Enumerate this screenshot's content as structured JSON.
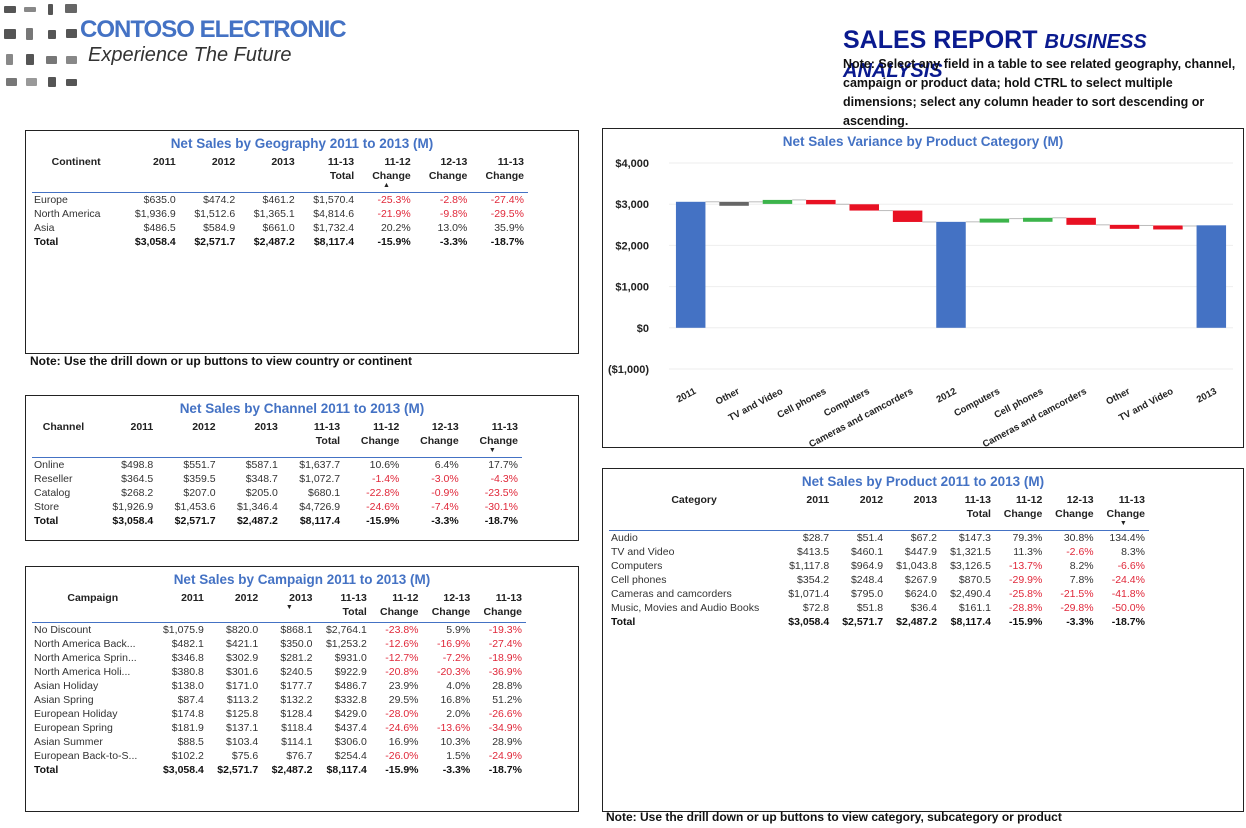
{
  "brand": {
    "name": "CONTOSO ELECTRONIC",
    "tagline": "Experience The Future"
  },
  "report": {
    "title": "SALES REPORT",
    "subtitle": "BUSINESS ANALYSIS",
    "note": "Note: Select any field in a table to see related geography, channel, campaign or product data; hold CTRL to select multiple dimensions; select any column header to sort descending or ascending."
  },
  "geography": {
    "title": "Net Sales by Geography 2011 to 2013 (M)",
    "headers": [
      "Continent",
      "2011",
      "2012",
      "2013",
      "11-13 Total",
      "11-12 Change",
      "12-13 Change",
      "11-13 Change"
    ],
    "rows": [
      [
        "Europe",
        "$635.0",
        "$474.2",
        "$461.2",
        "$1,570.4",
        "-25.3%",
        "-2.8%",
        "-27.4%"
      ],
      [
        "North America",
        "$1,936.9",
        "$1,512.6",
        "$1,365.1",
        "$4,814.6",
        "-21.9%",
        "-9.8%",
        "-29.5%"
      ],
      [
        "Asia",
        "$486.5",
        "$584.9",
        "$661.0",
        "$1,732.4",
        "20.2%",
        "13.0%",
        "35.9%"
      ]
    ],
    "total": [
      "Total",
      "$3,058.4",
      "$2,571.7",
      "$2,487.2",
      "$8,117.4",
      "-15.9%",
      "-3.3%",
      "-18.7%"
    ],
    "note": "Note: Use the drill down or up buttons to view country or continent"
  },
  "channel": {
    "title": "Net Sales by Channel 2011 to 2013 (M)",
    "headers": [
      "Channel",
      "2011",
      "2012",
      "2013",
      "11-13 Total",
      "11-12 Change",
      "12-13 Change",
      "11-13 Change"
    ],
    "rows": [
      [
        "Online",
        "$498.8",
        "$551.7",
        "$587.1",
        "$1,637.7",
        "10.6%",
        "6.4%",
        "17.7%"
      ],
      [
        "Reseller",
        "$364.5",
        "$359.5",
        "$348.7",
        "$1,072.7",
        "-1.4%",
        "-3.0%",
        "-4.3%"
      ],
      [
        "Catalog",
        "$268.2",
        "$207.0",
        "$205.0",
        "$680.1",
        "-22.8%",
        "-0.9%",
        "-23.5%"
      ],
      [
        "Store",
        "$1,926.9",
        "$1,453.6",
        "$1,346.4",
        "$4,726.9",
        "-24.6%",
        "-7.4%",
        "-30.1%"
      ]
    ],
    "total": [
      "Total",
      "$3,058.4",
      "$2,571.7",
      "$2,487.2",
      "$8,117.4",
      "-15.9%",
      "-3.3%",
      "-18.7%"
    ]
  },
  "campaign": {
    "title": "Net Sales by Campaign 2011 to 2013 (M)",
    "headers": [
      "Campaign",
      "2011",
      "2012",
      "2013",
      "11-13 Total",
      "11-12 Change",
      "12-13 Change",
      "11-13 Change"
    ],
    "rows": [
      [
        "No Discount",
        "$1,075.9",
        "$820.0",
        "$868.1",
        "$2,764.1",
        "-23.8%",
        "5.9%",
        "-19.3%"
      ],
      [
        "North America Back...",
        "$482.1",
        "$421.1",
        "$350.0",
        "$1,253.2",
        "-12.6%",
        "-16.9%",
        "-27.4%"
      ],
      [
        "North America Sprin...",
        "$346.8",
        "$302.9",
        "$281.2",
        "$931.0",
        "-12.7%",
        "-7.2%",
        "-18.9%"
      ],
      [
        "North America Holi...",
        "$380.8",
        "$301.6",
        "$240.5",
        "$922.9",
        "-20.8%",
        "-20.3%",
        "-36.9%"
      ],
      [
        "Asian Holiday",
        "$138.0",
        "$171.0",
        "$177.7",
        "$486.7",
        "23.9%",
        "4.0%",
        "28.8%"
      ],
      [
        "Asian Spring",
        "$87.4",
        "$113.2",
        "$132.2",
        "$332.8",
        "29.5%",
        "16.8%",
        "51.2%"
      ],
      [
        "European Holiday",
        "$174.8",
        "$125.8",
        "$128.4",
        "$429.0",
        "-28.0%",
        "2.0%",
        "-26.6%"
      ],
      [
        "European Spring",
        "$181.9",
        "$137.1",
        "$118.4",
        "$437.4",
        "-24.6%",
        "-13.6%",
        "-34.9%"
      ],
      [
        "Asian Summer",
        "$88.5",
        "$103.4",
        "$114.1",
        "$306.0",
        "16.9%",
        "10.3%",
        "28.9%"
      ],
      [
        "European Back-to-S...",
        "$102.2",
        "$75.6",
        "$76.7",
        "$254.4",
        "-26.0%",
        "1.5%",
        "-24.9%"
      ]
    ],
    "total": [
      "Total",
      "$3,058.4",
      "$2,571.7",
      "$2,487.2",
      "$8,117.4",
      "-15.9%",
      "-3.3%",
      "-18.7%"
    ]
  },
  "product": {
    "title": "Net Sales by Product 2011 to 2013 (M)",
    "headers": [
      "Category",
      "2011",
      "2012",
      "2013",
      "11-13 Total",
      "11-12 Change",
      "12-13 Change",
      "11-13 Change"
    ],
    "rows": [
      [
        "Audio",
        "$28.7",
        "$51.4",
        "$67.2",
        "$147.3",
        "79.3%",
        "30.8%",
        "134.4%"
      ],
      [
        "TV and Video",
        "$413.5",
        "$460.1",
        "$447.9",
        "$1,321.5",
        "11.3%",
        "-2.6%",
        "8.3%"
      ],
      [
        "Computers",
        "$1,117.8",
        "$964.9",
        "$1,043.8",
        "$3,126.5",
        "-13.7%",
        "8.2%",
        "-6.6%"
      ],
      [
        "Cell phones",
        "$354.2",
        "$248.4",
        "$267.9",
        "$870.5",
        "-29.9%",
        "7.8%",
        "-24.4%"
      ],
      [
        "Cameras and camcorders",
        "$1,071.4",
        "$795.0",
        "$624.0",
        "$2,490.4",
        "-25.8%",
        "-21.5%",
        "-41.8%"
      ],
      [
        "Music, Movies and Audio Books",
        "$72.8",
        "$51.8",
        "$36.4",
        "$161.1",
        "-28.8%",
        "-29.8%",
        "-50.0%"
      ]
    ],
    "total": [
      "Total",
      "$3,058.4",
      "$2,571.7",
      "$2,487.2",
      "$8,117.4",
      "-15.9%",
      "-3.3%",
      "-18.7%"
    ],
    "note": "Note: Use the drill down or up buttons to view category, subcategory or product"
  },
  "chart_data": {
    "type": "bar",
    "subtype": "waterfall",
    "title": "Net Sales Variance by Product Category (M)",
    "ylim": [
      -1000,
      4000
    ],
    "yticks": [
      "$4,000",
      "$3,000",
      "$2,000",
      "$1,000",
      "$0",
      "($1,000)"
    ],
    "ytick_values": [
      4000,
      3000,
      2000,
      1000,
      0,
      -1000
    ],
    "categories": [
      "2011",
      "Other",
      "TV and Video",
      "Cell phones",
      "Computers",
      "Cameras and camcorders",
      "2012",
      "Computers",
      "Cell phones",
      "Cameras and camcorders",
      "Other",
      "TV and Video",
      "2013"
    ],
    "values": [
      3058.4,
      -0.9,
      46.6,
      -105.8,
      -152.9,
      -276.4,
      2571.7,
      78.9,
      19.5,
      -171.0,
      -15.4,
      -12.2,
      2487.2
    ],
    "kinds": [
      "total",
      "delta",
      "delta",
      "delta",
      "delta",
      "delta",
      "total",
      "delta",
      "delta",
      "delta",
      "delta",
      "delta",
      "total"
    ],
    "colors": {
      "total": "#4472C4",
      "increase": "#3cb44b",
      "decrease": "#e81123",
      "other": "#666666"
    },
    "grid": true
  }
}
